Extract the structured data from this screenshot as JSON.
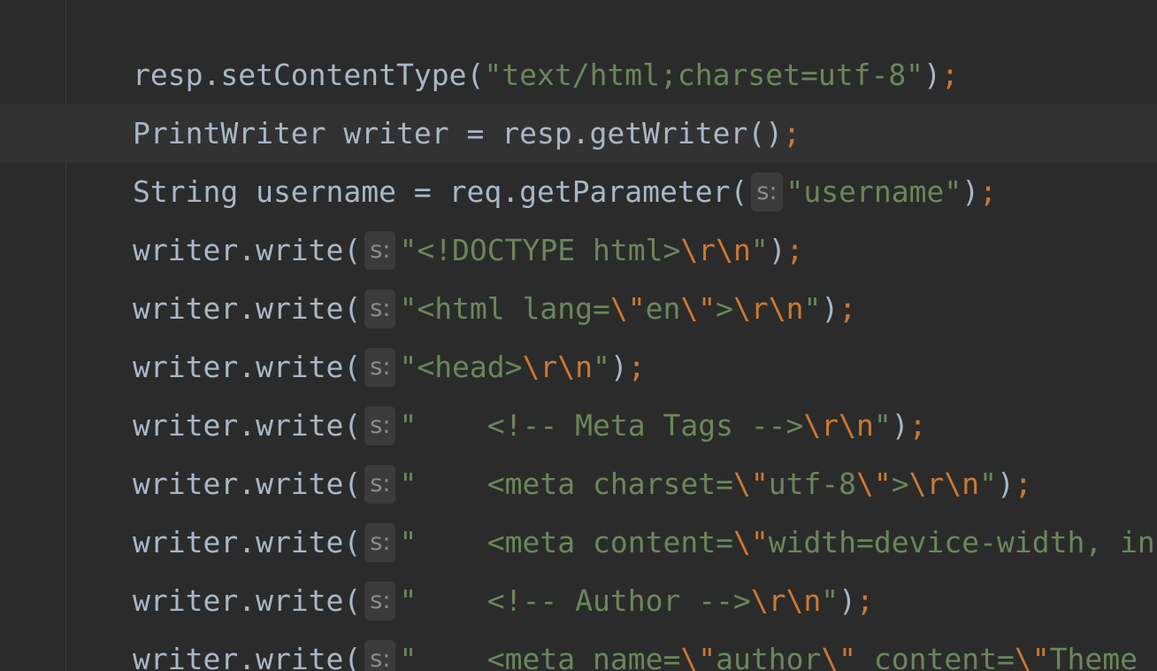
{
  "editor": {
    "param_hint": "s:",
    "lines": [
      {
        "current": false,
        "tokens": [
          {
            "t": "resp.setContentType(",
            "k": "id"
          },
          {
            "t": "\"text/html;charset=utf-8\"",
            "k": "str"
          },
          {
            "t": ")",
            "k": "id"
          },
          {
            "t": ";",
            "k": "semi"
          }
        ]
      },
      {
        "current": true,
        "tokens": [
          {
            "t": "PrintWriter writer = resp.getWriter()",
            "k": "id"
          },
          {
            "t": ";",
            "k": "semi"
          }
        ]
      },
      {
        "current": false,
        "tokens": [
          {
            "t": "String username = req.getParameter(",
            "k": "id"
          },
          {
            "t": "s:",
            "k": "hint"
          },
          {
            "t": "\"username\"",
            "k": "str"
          },
          {
            "t": ")",
            "k": "id"
          },
          {
            "t": ";",
            "k": "semi"
          }
        ]
      },
      {
        "current": false,
        "tokens": [
          {
            "t": "writer.write(",
            "k": "id"
          },
          {
            "t": "s:",
            "k": "hint"
          },
          {
            "t": "\"<!DOCTYPE html>",
            "k": "str"
          },
          {
            "t": "\\r\\n",
            "k": "esc"
          },
          {
            "t": "\"",
            "k": "str"
          },
          {
            "t": ")",
            "k": "id"
          },
          {
            "t": ";",
            "k": "semi"
          }
        ]
      },
      {
        "current": false,
        "tokens": [
          {
            "t": "writer.write(",
            "k": "id"
          },
          {
            "t": "s:",
            "k": "hint"
          },
          {
            "t": "\"<html lang=",
            "k": "str"
          },
          {
            "t": "\\\"",
            "k": "esc"
          },
          {
            "t": "en",
            "k": "str"
          },
          {
            "t": "\\\"",
            "k": "esc"
          },
          {
            "t": ">",
            "k": "str"
          },
          {
            "t": "\\r\\n",
            "k": "esc"
          },
          {
            "t": "\"",
            "k": "str"
          },
          {
            "t": ")",
            "k": "id"
          },
          {
            "t": ";",
            "k": "semi"
          }
        ]
      },
      {
        "current": false,
        "tokens": [
          {
            "t": "writer.write(",
            "k": "id"
          },
          {
            "t": "s:",
            "k": "hint"
          },
          {
            "t": "\"<head>",
            "k": "str"
          },
          {
            "t": "\\r\\n",
            "k": "esc"
          },
          {
            "t": "\"",
            "k": "str"
          },
          {
            "t": ")",
            "k": "id"
          },
          {
            "t": ";",
            "k": "semi"
          }
        ]
      },
      {
        "current": false,
        "tokens": [
          {
            "t": "writer.write(",
            "k": "id"
          },
          {
            "t": "s:",
            "k": "hint"
          },
          {
            "t": "\"    <!-- Meta Tags -->",
            "k": "str"
          },
          {
            "t": "\\r\\n",
            "k": "esc"
          },
          {
            "t": "\"",
            "k": "str"
          },
          {
            "t": ")",
            "k": "id"
          },
          {
            "t": ";",
            "k": "semi"
          }
        ]
      },
      {
        "current": false,
        "tokens": [
          {
            "t": "writer.write(",
            "k": "id"
          },
          {
            "t": "s:",
            "k": "hint"
          },
          {
            "t": "\"    <meta charset=",
            "k": "str"
          },
          {
            "t": "\\\"",
            "k": "esc"
          },
          {
            "t": "utf-8",
            "k": "str"
          },
          {
            "t": "\\\"",
            "k": "esc"
          },
          {
            "t": ">",
            "k": "str"
          },
          {
            "t": "\\r\\n",
            "k": "esc"
          },
          {
            "t": "\"",
            "k": "str"
          },
          {
            "t": ")",
            "k": "id"
          },
          {
            "t": ";",
            "k": "semi"
          }
        ]
      },
      {
        "current": false,
        "tokens": [
          {
            "t": "writer.write(",
            "k": "id"
          },
          {
            "t": "s:",
            "k": "hint"
          },
          {
            "t": "\"    <meta content=",
            "k": "str"
          },
          {
            "t": "\\\"",
            "k": "esc"
          },
          {
            "t": "width=device-width, in",
            "k": "str"
          }
        ]
      },
      {
        "current": false,
        "tokens": [
          {
            "t": "writer.write(",
            "k": "id"
          },
          {
            "t": "s:",
            "k": "hint"
          },
          {
            "t": "\"    <!-- Author -->",
            "k": "str"
          },
          {
            "t": "\\r\\n",
            "k": "esc"
          },
          {
            "t": "\"",
            "k": "str"
          },
          {
            "t": ")",
            "k": "id"
          },
          {
            "t": ";",
            "k": "semi"
          }
        ]
      },
      {
        "current": false,
        "tokens": [
          {
            "t": "writer.write(",
            "k": "id"
          },
          {
            "t": "s:",
            "k": "hint"
          },
          {
            "t": "\"    <meta name=",
            "k": "str"
          },
          {
            "t": "\\\"",
            "k": "esc"
          },
          {
            "t": "author",
            "k": "str"
          },
          {
            "t": "\\\"",
            "k": "esc"
          },
          {
            "t": " content=",
            "k": "str"
          },
          {
            "t": "\\\"",
            "k": "esc"
          },
          {
            "t": "Theme",
            "k": "str"
          }
        ]
      }
    ]
  }
}
